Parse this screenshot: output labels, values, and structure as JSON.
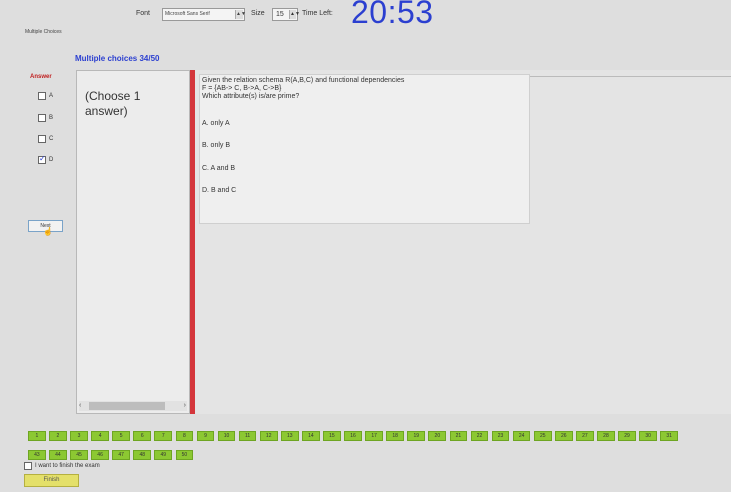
{
  "header": {
    "font_label": "Font",
    "font_value": "Microsoft Sans Serif",
    "size_label": "Size",
    "size_value": "15",
    "time_left_label": "Time Left:",
    "timer": "20:53"
  },
  "window": {
    "tab_title": "Multiple Choices"
  },
  "section": {
    "title": "Multiple choices 34/50"
  },
  "answer": {
    "label": "Answer",
    "options": [
      {
        "letter": "A",
        "checked": false
      },
      {
        "letter": "B",
        "checked": false
      },
      {
        "letter": "C",
        "checked": false
      },
      {
        "letter": "D",
        "checked": true
      }
    ],
    "next_label": "Next"
  },
  "hint": {
    "text": "(Choose 1 answer)"
  },
  "question": {
    "line1": "Given the relation schema R(A,B,C) and functional dependencies",
    "line2": "F = {AB-> C, B->A, C->B}",
    "line3": "Which attribute(s) is/are prime?",
    "choices": [
      "A. only A",
      "B. only B",
      "C. A and B",
      "D. B and C"
    ]
  },
  "navigation": {
    "row1": [
      "1",
      "2",
      "3",
      "4",
      "5",
      "6",
      "7",
      "8",
      "9",
      "10",
      "11",
      "12",
      "13",
      "14",
      "15",
      "16",
      "17",
      "18",
      "19",
      "20",
      "21",
      "22",
      "23",
      "24",
      "25",
      "26",
      "27",
      "28",
      "29",
      "30",
      "31"
    ],
    "row2": [
      "43",
      "44",
      "45",
      "46",
      "47",
      "48",
      "49",
      "50"
    ],
    "status_color": "#8cc832"
  },
  "footer": {
    "finish_checkbox_label": "I want to finish the exam",
    "finish_label": "Finish"
  },
  "colors": {
    "timer": "#2b3fd0",
    "accent_red": "#d4363b",
    "title_blue": "#2b3fd0"
  }
}
